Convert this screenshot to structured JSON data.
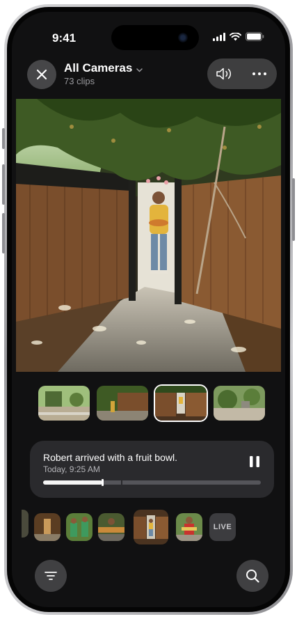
{
  "status_bar": {
    "time": "9:41"
  },
  "header": {
    "title": "All Cameras",
    "subtitle": "73 clips",
    "icons": [
      "close-icon",
      "chevron-down-icon",
      "speaker-icon",
      "more-icon"
    ]
  },
  "clip_card": {
    "title": "Robert arrived with a fruit bowl.",
    "timestamp": "Today, 9:25 AM",
    "progress": 0.27
  },
  "timeline": {
    "live_label": "LIVE"
  },
  "bottom_bar": {
    "icons": [
      "filter-icon",
      "search-icon"
    ]
  },
  "colors": {
    "background": "#111112",
    "card": "#2a2a2d",
    "accent": "#ffffff"
  }
}
